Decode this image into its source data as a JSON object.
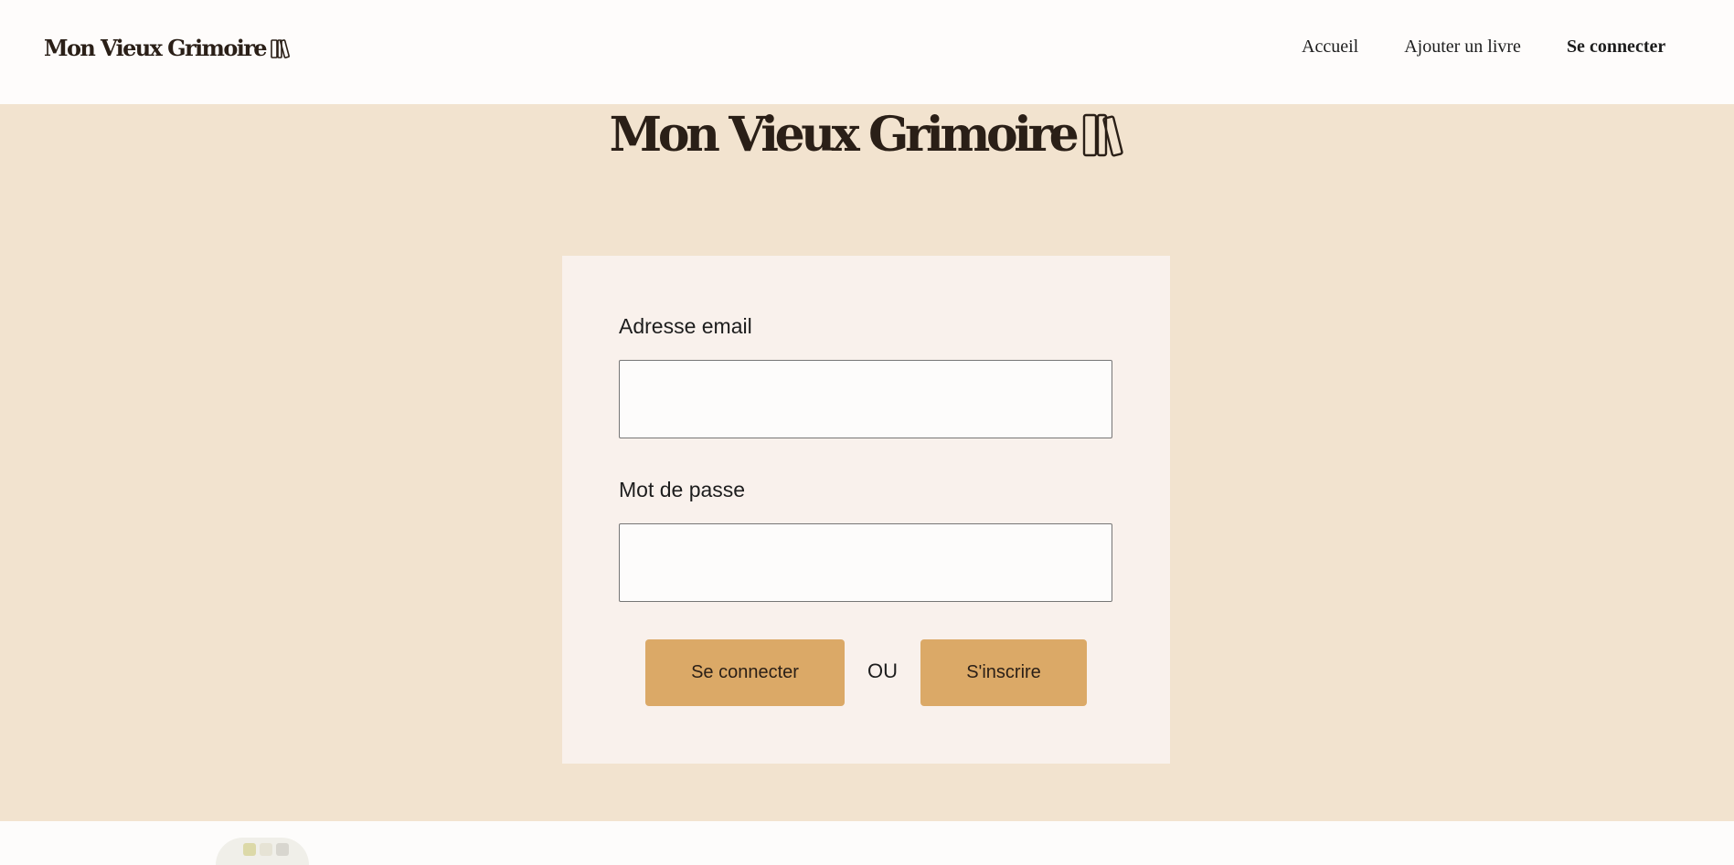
{
  "header": {
    "logo_text": "Mon Vieux Grimoire",
    "logo_icon": "books-icon"
  },
  "nav": {
    "items": [
      {
        "label": "Accueil"
      },
      {
        "label": "Ajouter un livre"
      },
      {
        "label": "Se connecter"
      }
    ]
  },
  "hero": {
    "title": "Mon Vieux Grimoire",
    "icon": "books-icon"
  },
  "form": {
    "email_label": "Adresse email",
    "email_value": "",
    "password_label": "Mot de passe",
    "password_value": "",
    "login_button": "Se connecter",
    "or_text": "OU",
    "signup_button": "S'inscrire"
  },
  "footer": {
    "logo_icon": "footer-logo-icon"
  },
  "colors": {
    "background_beige": "#f2e3cf",
    "card": "#f9f1ec",
    "button": "#dba967",
    "text_dark": "#2a1f17"
  }
}
